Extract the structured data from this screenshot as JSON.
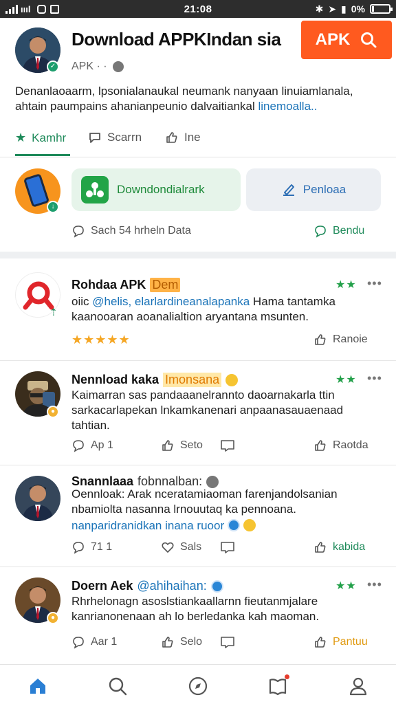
{
  "status_bar": {
    "carrier": "ıııl",
    "time": "21:08",
    "battery_text": "0%"
  },
  "header": {
    "title": "Download APPKIndan sia",
    "subtitle": "APK · ·",
    "apk_button_label": "APK",
    "description_line1": "Denanlaoaarm, lpsonialanaukal neumank nanyaan linuiamlanala,",
    "description_line2": "ahtain paumpains ahanianpeunio dalvaitiankal ",
    "description_link": "linemoalla.."
  },
  "tabs": [
    {
      "label": "Kamhr"
    },
    {
      "label": "Scarrn"
    },
    {
      "label": "Ine"
    }
  ],
  "download_card": {
    "primary_label": "Downdondialrark",
    "secondary_label": "Penloaa",
    "meta_left": "Sach  54 hrheln Data",
    "meta_right": "Bendu"
  },
  "posts": [
    {
      "name": "Rohdaa APK",
      "tag": "Dem",
      "handle": "",
      "body_prefix": "oiic ",
      "body_link": "@helis, elarlardineanalapanka",
      "body_rest": " Hama tantamka kaanooaran aoanalialtion aryantana msunten.",
      "stars_green": "★★",
      "rating": "★★★★★",
      "actions": {
        "left_count": "",
        "middle": "",
        "right": "Ranoie"
      }
    },
    {
      "name": "Nennload kaka",
      "tag": "Imonsana",
      "handle": "",
      "body_prefix": "",
      "body_link": "",
      "body_rest": "Kaimarran sas pandaaanelrannto daoarnakarla ttin sarkacarlapekan lnkamkanenari anpaanasauaenaad tahtian.",
      "stars_green": "★★",
      "rating": "",
      "actions": {
        "left_count": "Ap   1",
        "middle": "Seto",
        "right": "Raotda"
      }
    },
    {
      "name": "Snannlaaa",
      "tag": "",
      "handle": "fobnnalban:",
      "body_prefix": "",
      "body_link": "",
      "body_rest": "Oennloak: Arak nceratamiaoman farenjandolsanian nbamiolta nasanna lrnouutaq ka pennoana.",
      "extra_link": "nanparidranidkan inana ruoor",
      "stars_green": "",
      "rating": "",
      "actions": {
        "left_count": "71   1",
        "middle": "Sals",
        "right": "kabida"
      }
    },
    {
      "name": "Doern Aek",
      "tag": "",
      "handle": "@ahihaihan:",
      "body_prefix": "",
      "body_link": "",
      "body_rest": "Rhrhelonagn asoslstiankaallarnn fieutanmjalare kanrianonenaan ah lo berledanka kah maoman.",
      "stars_green": "★★",
      "rating": "",
      "actions": {
        "left_count": "Aar   1",
        "middle": "Selo",
        "right": "Pantuu"
      }
    }
  ],
  "colors": {
    "accent_green": "#1e8a5a",
    "apk_orange": "#ff5a1f",
    "link_blue": "#1a73b8",
    "star_gold": "#f5a623"
  }
}
